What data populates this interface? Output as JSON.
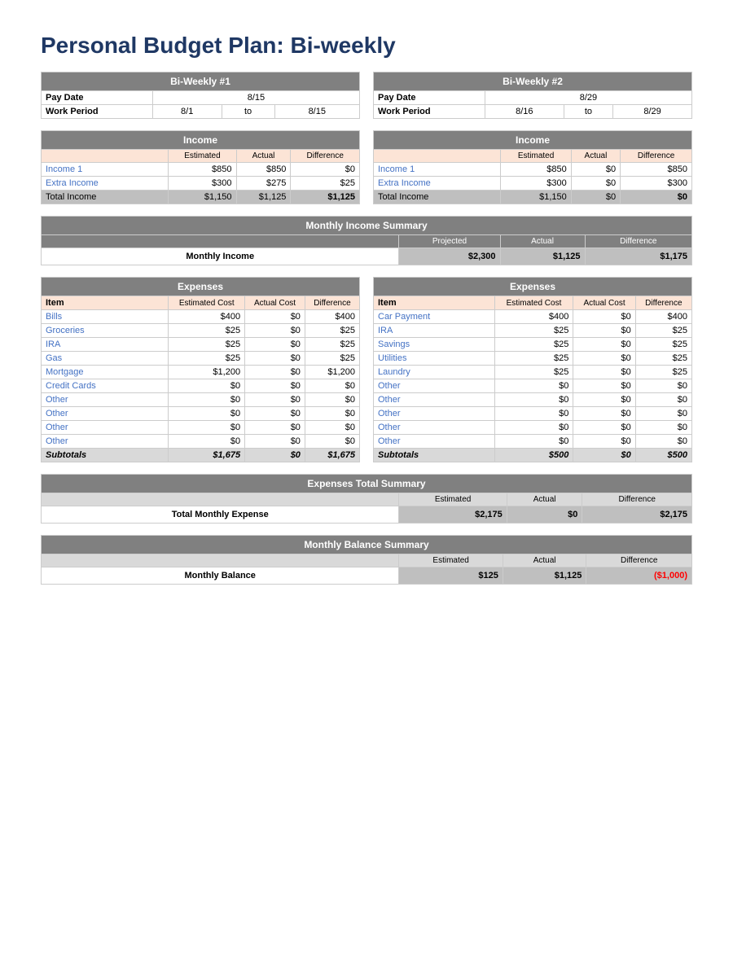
{
  "title": "Personal Budget Plan: Bi-weekly",
  "biweekly1": {
    "header": "Bi-Weekly #1",
    "payDateLabel": "Pay Date",
    "payDateValue": "8/15",
    "workPeriodLabel": "Work Period",
    "workPeriodStart": "8/1",
    "workPeriodTo": "to",
    "workPeriodEnd": "8/15",
    "incomeHeader": "Income",
    "columns": [
      "Estimated",
      "Actual",
      "Difference"
    ],
    "incomeRows": [
      {
        "label": "Income 1",
        "estimated": "$850",
        "actual": "$850",
        "difference": "$0"
      },
      {
        "label": "Extra Income",
        "estimated": "$300",
        "actual": "$275",
        "difference": "$25"
      }
    ],
    "totalIncome": {
      "label": "Total Income",
      "estimated": "$1,150",
      "actual": "$1,125",
      "difference": "$1,125"
    },
    "expensesHeader": "Expenses",
    "expColumns": [
      "Estimated Cost",
      "Actual Cost",
      "Difference"
    ],
    "expRows": [
      {
        "label": "Bills",
        "estimated": "$400",
        "actual": "$0",
        "difference": "$400"
      },
      {
        "label": "Groceries",
        "estimated": "$25",
        "actual": "$0",
        "difference": "$25"
      },
      {
        "label": "IRA",
        "estimated": "$25",
        "actual": "$0",
        "difference": "$25"
      },
      {
        "label": "Gas",
        "estimated": "$25",
        "actual": "$0",
        "difference": "$25"
      },
      {
        "label": "Mortgage",
        "estimated": "$1,200",
        "actual": "$0",
        "difference": "$1,200"
      },
      {
        "label": "Credit Cards",
        "estimated": "$0",
        "actual": "$0",
        "difference": "$0"
      },
      {
        "label": "Other",
        "estimated": "$0",
        "actual": "$0",
        "difference": "$0"
      },
      {
        "label": "Other",
        "estimated": "$0",
        "actual": "$0",
        "difference": "$0"
      },
      {
        "label": "Other",
        "estimated": "$0",
        "actual": "$0",
        "difference": "$0"
      },
      {
        "label": "Other",
        "estimated": "$0",
        "actual": "$0",
        "difference": "$0"
      }
    ],
    "subtotal": {
      "label": "Subtotals",
      "estimated": "$1,675",
      "actual": "$0",
      "difference": "$1,675"
    }
  },
  "biweekly2": {
    "header": "Bi-Weekly #2",
    "payDateLabel": "Pay Date",
    "payDateValue": "8/29",
    "workPeriodLabel": "Work Period",
    "workPeriodStart": "8/16",
    "workPeriodTo": "to",
    "workPeriodEnd": "8/29",
    "incomeHeader": "Income",
    "columns": [
      "Estimated",
      "Actual",
      "Difference"
    ],
    "incomeRows": [
      {
        "label": "Income 1",
        "estimated": "$850",
        "actual": "$0",
        "difference": "$850"
      },
      {
        "label": "Extra Income",
        "estimated": "$300",
        "actual": "$0",
        "difference": "$300"
      }
    ],
    "totalIncome": {
      "label": "Total Income",
      "estimated": "$1,150",
      "actual": "$0",
      "difference": "$0"
    },
    "expensesHeader": "Expenses",
    "expColumns": [
      "Estimated Cost",
      "Actual Cost",
      "Difference"
    ],
    "expRows": [
      {
        "label": "Car Payment",
        "estimated": "$400",
        "actual": "$0",
        "difference": "$400"
      },
      {
        "label": "IRA",
        "estimated": "$25",
        "actual": "$0",
        "difference": "$25"
      },
      {
        "label": "Savings",
        "estimated": "$25",
        "actual": "$0",
        "difference": "$25"
      },
      {
        "label": "Utilities",
        "estimated": "$25",
        "actual": "$0",
        "difference": "$25"
      },
      {
        "label": "Laundry",
        "estimated": "$25",
        "actual": "$0",
        "difference": "$25"
      },
      {
        "label": "Other",
        "estimated": "$0",
        "actual": "$0",
        "difference": "$0"
      },
      {
        "label": "Other",
        "estimated": "$0",
        "actual": "$0",
        "difference": "$0"
      },
      {
        "label": "Other",
        "estimated": "$0",
        "actual": "$0",
        "difference": "$0"
      },
      {
        "label": "Other",
        "estimated": "$0",
        "actual": "$0",
        "difference": "$0"
      },
      {
        "label": "Other",
        "estimated": "$0",
        "actual": "$0",
        "difference": "$0"
      }
    ],
    "subtotal": {
      "label": "Subtotals",
      "estimated": "$500",
      "actual": "$0",
      "difference": "$500"
    }
  },
  "monthlyIncomeSummary": {
    "header": "Monthly Income Summary",
    "columns": [
      "Projected",
      "Actual",
      "Difference"
    ],
    "label": "Monthly Income",
    "projected": "$2,300",
    "actual": "$1,125",
    "difference": "$1,175"
  },
  "expensesTotalSummary": {
    "header": "Expenses Total Summary",
    "columns": [
      "Estimated",
      "Actual",
      "Difference"
    ],
    "label": "Total Monthly Expense",
    "estimated": "$2,175",
    "actual": "$0",
    "difference": "$2,175"
  },
  "monthlyBalanceSummary": {
    "header": "Monthly Balance Summary",
    "columns": [
      "Estimated",
      "Actual",
      "Difference"
    ],
    "label": "Monthly Balance",
    "estimated": "$125",
    "actual": "$1,125",
    "difference": "($1,000)"
  }
}
